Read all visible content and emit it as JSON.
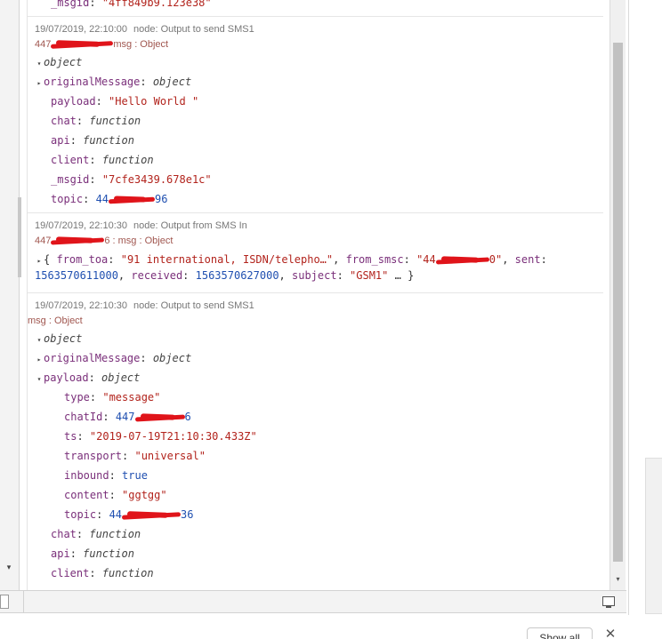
{
  "messages": [
    {
      "partial_row": {
        "key": "_msgid",
        "value": "\"4ff849b9.123e38\""
      }
    },
    {
      "meta": {
        "timestamp": "19/07/2019, 22:10:00",
        "node": "node: Output to send SMS1"
      },
      "topic": {
        "prefix": "447",
        "suffix": "msg : Object"
      },
      "root": {
        "toggle": "▾",
        "type": "object"
      },
      "rows": [
        {
          "toggle": "▸",
          "key": "originalMessage",
          "value": "object",
          "vtype": "type"
        },
        {
          "key": "payload",
          "value": "\"Hello World \"",
          "vtype": "str"
        },
        {
          "key": "chat",
          "value": "function",
          "vtype": "type"
        },
        {
          "key": "api",
          "value": "function",
          "vtype": "type"
        },
        {
          "key": "client",
          "value": "function",
          "vtype": "type"
        },
        {
          "key": "_msgid",
          "value": "\"7cfe3439.678e1c\"",
          "vtype": "str"
        },
        {
          "key": "topic",
          "value_prefix": "44",
          "value_suffix": "96",
          "vtype": "num"
        }
      ]
    },
    {
      "meta": {
        "timestamp": "19/07/2019, 22:10:30",
        "node": "node: Output from SMS In"
      },
      "topic": {
        "prefix": "447",
        "suffix": "6 : msg : Object"
      },
      "summary": {
        "toggle": "▸",
        "open": "{",
        "k1": "from_toa",
        "v1": "\"91 international, ISDN/telepho…\"",
        "k2": "from_smsc",
        "v2_prefix": "\"44",
        "v2_suffix": "0\"",
        "k3": "sent",
        "v3": "1563570611000",
        "k4": "received",
        "v4": "1563570627000",
        "k5": "subject",
        "v5": "\"GSM1\"",
        "close": "… }"
      }
    },
    {
      "meta": {
        "timestamp": "19/07/2019, 22:10:30",
        "node": "node: Output to send SMS1"
      },
      "topic": {
        "suffix": "msg : Object"
      },
      "root": {
        "toggle": "▾",
        "type": "object"
      },
      "original": {
        "toggle": "▸",
        "key": "originalMessage",
        "value": "object"
      },
      "payload": {
        "toggle": "▾",
        "key": "payload",
        "value": "object"
      },
      "payload_rows": [
        {
          "key": "type",
          "value": "\"message\"",
          "vtype": "str"
        },
        {
          "key": "chatId",
          "value_prefix": "447",
          "value_suffix": "6",
          "vtype": "num"
        },
        {
          "key": "ts",
          "value": "\"2019-07-19T21:10:30.433Z\"",
          "vtype": "str"
        },
        {
          "key": "transport",
          "value": "\"universal\"",
          "vtype": "str"
        },
        {
          "key": "inbound",
          "value": "true",
          "vtype": "bool"
        },
        {
          "key": "content",
          "value": "\"ggtgg\"",
          "vtype": "str"
        },
        {
          "key": "topic",
          "value_prefix": "44",
          "value_suffix": "36",
          "vtype": "num"
        }
      ],
      "tail_rows": [
        {
          "key": "chat",
          "value": "function"
        },
        {
          "key": "api",
          "value": "function"
        },
        {
          "key": "client",
          "value": "function"
        }
      ]
    }
  ],
  "download_bar": {
    "show_all_label": "Show all",
    "close_glyph": "✕"
  },
  "scroll": {
    "down_arrow": "▾",
    "left_arrow": "▾"
  }
}
